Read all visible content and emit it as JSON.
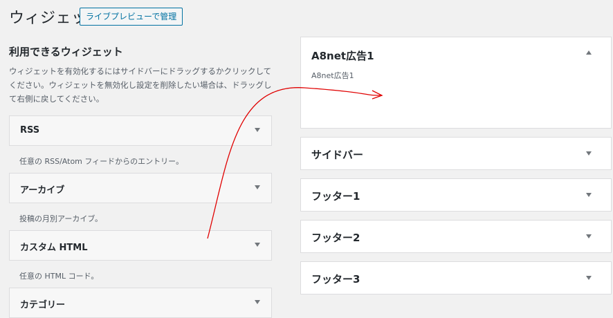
{
  "header": {
    "title": "ウィジェット",
    "live_preview_label": "ライブプレビューで管理"
  },
  "available": {
    "title": "利用できるウィジェット",
    "description_1": "ウィジェットを有効化するにはサイドバーにドラッグするかクリックしてください。",
    "description_2": "ウィジェットを無効化し設定を削除したい場合は、ドラッグして右側に戻してください。",
    "widgets": [
      {
        "name": "RSS",
        "description": "任意の RSS/Atom フィードからのエントリー。"
      },
      {
        "name": "アーカイブ",
        "description": "投稿の月別アーカイブ。"
      },
      {
        "name": "カスタム HTML",
        "description": "任意の HTML コード。"
      },
      {
        "name": "カテゴリー",
        "description": ""
      }
    ]
  },
  "sidebars": [
    {
      "name": "A8net広告1",
      "description": "A8net広告1",
      "expanded": true
    },
    {
      "name": "サイドバー",
      "expanded": false
    },
    {
      "name": "フッター1",
      "expanded": false
    },
    {
      "name": "フッター2",
      "expanded": false
    },
    {
      "name": "フッター3",
      "expanded": false
    }
  ],
  "colors": {
    "annotation_arrow": "#e00000",
    "button_accent": "#0071a1"
  },
  "icons": {
    "collapse": "triangle-up-icon",
    "expand": "triangle-down-icon"
  }
}
